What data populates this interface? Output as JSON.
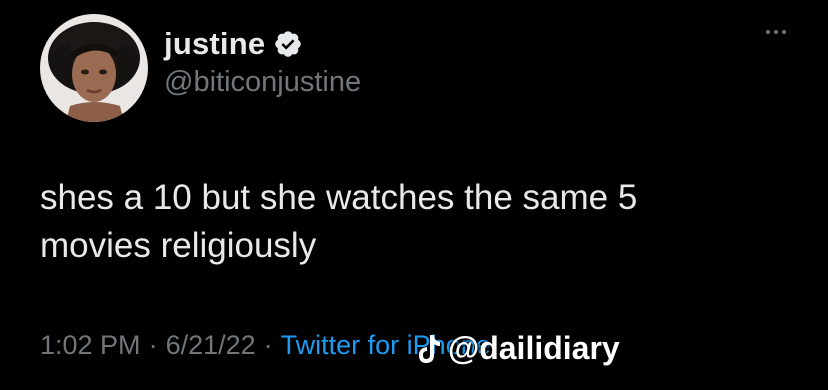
{
  "user": {
    "display_name": "justine",
    "handle": "@biticonjustine",
    "verified": true,
    "avatar_icon": "profile-photo"
  },
  "tweet": {
    "text": "shes a 10 but she watches the same 5\nmovies religiously"
  },
  "meta": {
    "time": "1:02 PM",
    "separator": "·",
    "date": "6/21/22",
    "source": "Twitter for iPhone"
  },
  "watermark": {
    "icon": "tiktok-icon",
    "text": "@dailidiary"
  },
  "colors": {
    "background": "#000000",
    "text": "#e7e9ea",
    "secondary": "#71767b",
    "accent": "#1d9bf0"
  }
}
